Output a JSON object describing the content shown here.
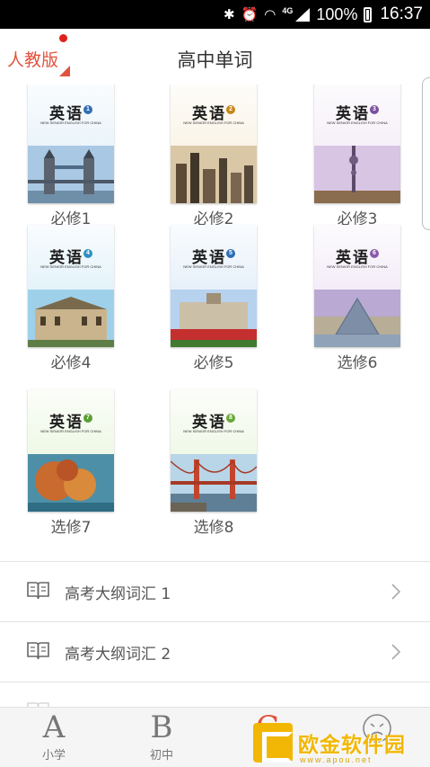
{
  "status_bar": {
    "network": "4G",
    "battery": "100%",
    "time": "16:37",
    "icons": [
      "bluetooth-icon",
      "alarm-icon",
      "wifi-icon",
      "signal-icon",
      "battery-icon"
    ]
  },
  "header": {
    "edition": "人教版",
    "title": "高中单词"
  },
  "books": [
    {
      "label": "必修1",
      "cover_title": "英语",
      "cover_number": "1",
      "accent": "#2f6fb3",
      "sky": "#cfe6f5",
      "scene": "tower-bridge"
    },
    {
      "label": "必修2",
      "cover_title": "英语",
      "cover_number": "2",
      "accent": "#c8861c",
      "sky": "#f4e6c9",
      "scene": "city-skyline"
    },
    {
      "label": "必修3",
      "cover_title": "英语",
      "cover_number": "3",
      "accent": "#7a4fa0",
      "sky": "#e9dcef",
      "scene": "tv-tower"
    },
    {
      "label": "必修4",
      "cover_title": "英语",
      "cover_number": "4",
      "accent": "#2f8fc4",
      "sky": "#bfe3f3",
      "scene": "palace"
    },
    {
      "label": "必修5",
      "cover_title": "英语",
      "cover_number": "5",
      "accent": "#2d6db6",
      "sky": "#c6dcf3",
      "scene": "tulips"
    },
    {
      "label": "选修6",
      "cover_title": "英语",
      "cover_number": "6",
      "accent": "#8a5aa8",
      "sky": "#e4d4ee",
      "scene": "louvre"
    },
    {
      "label": "选修7",
      "cover_title": "英语",
      "cover_number": "7",
      "accent": "#5a9e35",
      "sky": "#d8efc3",
      "scene": "coral"
    },
    {
      "label": "选修8",
      "cover_title": "英语",
      "cover_number": "8",
      "accent": "#6aa63a",
      "sky": "#dcefc8",
      "scene": "golden-gate"
    }
  ],
  "cover_english": "NEW SENIOR ENGLISH FOR CHINA",
  "vocab_list": [
    {
      "label": "高考大纲词汇 1"
    },
    {
      "label": "高考大纲词汇 2"
    }
  ],
  "tabs": [
    {
      "glyph": "A",
      "label": "小学",
      "active": false
    },
    {
      "glyph": "B",
      "label": "初中",
      "active": false
    },
    {
      "glyph": "C",
      "label": "",
      "active": true
    },
    {
      "glyph": "",
      "label": "",
      "active": false
    }
  ],
  "watermark": {
    "text": "欧金软件园",
    "url": "www.apou.net"
  },
  "colors": {
    "accent": "#e0533e",
    "text": "#555555",
    "divider": "#e2e2e2"
  }
}
